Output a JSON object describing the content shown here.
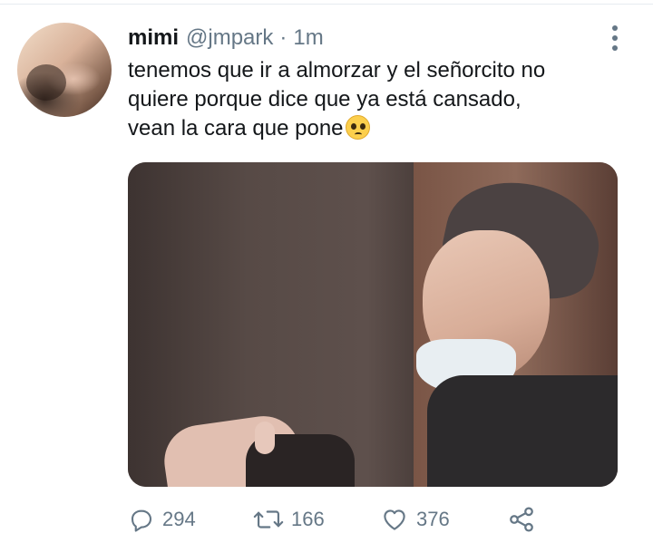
{
  "tweet": {
    "author_name": "mimi",
    "author_handle": "@jmpark",
    "separator": "·",
    "timestamp": "1m",
    "text_lines": [
      "tenemos que ir a almorzar y el señorcito no",
      "quiere porque dice que ya está cansado,",
      "vean la cara que pone"
    ],
    "emoji": "pleading-face",
    "actions": {
      "reply_count": "294",
      "retweet_count": "166",
      "like_count": "376"
    }
  },
  "icons": [
    "more-options-icon",
    "reply-icon",
    "retweet-icon",
    "like-icon",
    "share-icon",
    "pleading-face-emoji"
  ],
  "colors": {
    "text": "#14171a",
    "secondary": "#657786",
    "divider": "#e6ecf0"
  }
}
